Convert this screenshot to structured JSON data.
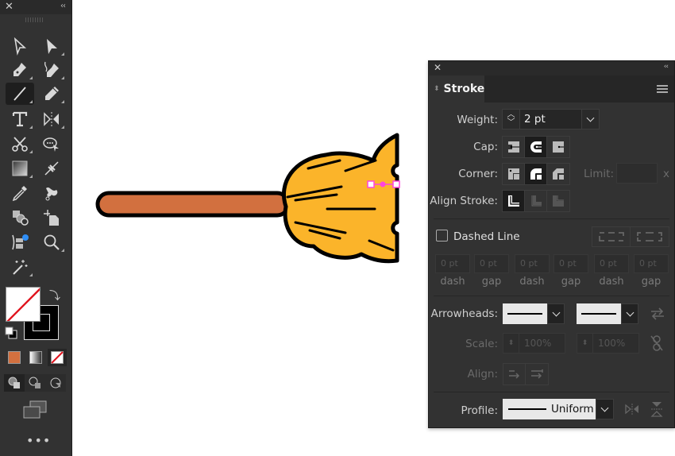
{
  "toolbar": {
    "close_icon": "close-icon",
    "collapse_icon": "collapse-icon",
    "tools": [
      {
        "name": "selection-tool",
        "icon": "arrow-outline-icon"
      },
      {
        "name": "direct-selection-tool",
        "icon": "arrow-solid-icon"
      },
      {
        "name": "pen-tool",
        "icon": "pen-icon"
      },
      {
        "name": "curvature-tool",
        "icon": "curvature-pen-icon"
      },
      {
        "name": "line-segment-tool",
        "icon": "line-icon",
        "active": true
      },
      {
        "name": "pencil-tool",
        "icon": "pencil-icon"
      },
      {
        "name": "type-tool",
        "icon": "type-icon"
      },
      {
        "name": "reflect-tool",
        "icon": "reflect-icon"
      },
      {
        "name": "scissors-tool",
        "icon": "scissors-icon"
      },
      {
        "name": "puppet-warp-tool",
        "icon": "puppet-icon"
      },
      {
        "name": "gradient-tool",
        "icon": "gradient-icon"
      },
      {
        "name": "width-tool",
        "icon": "width-icon"
      },
      {
        "name": "eyedropper-tool",
        "icon": "eyedropper-icon"
      },
      {
        "name": "blend-tool",
        "icon": "blend-icon"
      },
      {
        "name": "shape-builder-tool",
        "icon": "shape-builder-icon"
      },
      {
        "name": "artboard-tool",
        "icon": "artboard-icon"
      },
      {
        "name": "graph-tool",
        "icon": "graph-icon"
      },
      {
        "name": "zoom-tool",
        "icon": "magnifier-icon"
      },
      {
        "name": "magic-wand-tool",
        "icon": "magic-wand-icon"
      }
    ],
    "fill_color": "none",
    "stroke_color": "#000000",
    "color_mode_color": "#d2703f",
    "more_label": "•••"
  },
  "canvas": {
    "handle_color": "#ff44dd",
    "bristle_color": "#fbb42a",
    "handle_stick_color": "#d2703f",
    "outline_color": "#000000"
  },
  "stroke_panel": {
    "title": "Stroke",
    "weight_label": "Weight:",
    "weight_value": "2 pt",
    "cap_label": "Cap:",
    "cap_options": [
      "butt-cap",
      "round-cap",
      "projecting-cap"
    ],
    "cap_selected": "round-cap",
    "corner_label": "Corner:",
    "corner_options": [
      "miter-join",
      "round-join",
      "bevel-join"
    ],
    "corner_selected": "round-join",
    "limit_label": "Limit:",
    "limit_value": "",
    "limit_suffix": "x",
    "align_label": "Align Stroke:",
    "align_options": [
      "align-center",
      "align-inside",
      "align-outside"
    ],
    "align_selected": "align-center",
    "dashed_label": "Dashed Line",
    "dashed_checked": false,
    "dash_fields": [
      {
        "value": "0 pt",
        "label": "dash"
      },
      {
        "value": "0 pt",
        "label": "gap"
      },
      {
        "value": "0 pt",
        "label": "dash"
      },
      {
        "value": "0 pt",
        "label": "gap"
      },
      {
        "value": "0 pt",
        "label": "dash"
      },
      {
        "value": "0 pt",
        "label": "gap"
      }
    ],
    "arrowheads_label": "Arrowheads:",
    "scale_label": "Scale:",
    "scale_start": "100%",
    "scale_end": "100%",
    "align_arrow_label": "Align:",
    "profile_label": "Profile:",
    "profile_value": "Uniform"
  }
}
